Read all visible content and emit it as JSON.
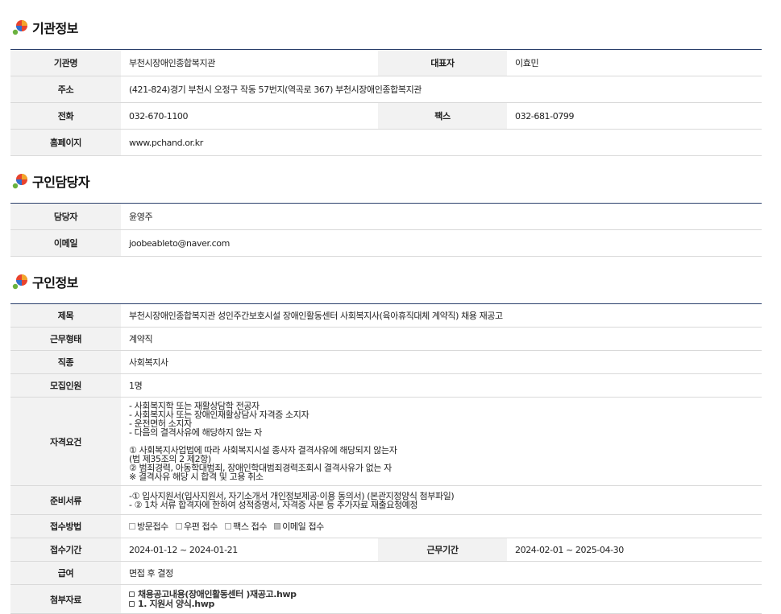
{
  "sections": {
    "agency": {
      "title": "기관정보"
    },
    "contact": {
      "title": "구인담당자"
    },
    "job": {
      "title": "구인정보"
    }
  },
  "agency": {
    "name_label": "기관명",
    "name": "부천시장애인종합복지관",
    "rep_label": "대표자",
    "rep": "이효민",
    "address_label": "주소",
    "address": "(421-824)경기 부천시 오정구 작동 57번지(역곡로 367) 부천시장애인종합복지관",
    "phone_label": "전화",
    "phone": "032-670-1100",
    "fax_label": "팩스",
    "fax": "032-681-0799",
    "homepage_label": "홈페이지",
    "homepage": "www.pchand.or.kr"
  },
  "contact": {
    "person_label": "담당자",
    "person": "윤영주",
    "email_label": "이메일",
    "email": "joobeableto@naver.com"
  },
  "job": {
    "title_label": "제목",
    "title": "부천시장애인종합복지관 성인주간보호시설 장애인활동센터 사회복지사(육아휴직대체 계약직) 채용 재공고",
    "worktype_label": "근무형태",
    "worktype": "계약직",
    "category_label": "직종",
    "category": "사회복지사",
    "headcount_label": "모집인원",
    "headcount": "1명",
    "qual_label": "자격요건",
    "qual_lines": [
      "- 사회복지학 또는 재활상담학 전공자",
      "  - 사회복지사 또는 장애인재활상담사 자격증 소지자",
      "  - 운전면허 소지자",
      "  - 다음의 결격사유에 해당하지 않는 자",
      "",
      "① 사회복지사업법에 따라 사회복지시설 종사자 결격사유에 해당되지 않는자",
      "   (법 제35조의 2 제2항)",
      "② 범죄경력, 아동학대범죄, 장애인학대범죄경력조회시 결격사유가 없는 자",
      "  ※ 결격사유 해당 시 합격 및 고용 취소"
    ],
    "docs_label": "준비서류",
    "docs_lines": [
      "-① 입사지원서(입사지원서, 자기소개서 개인정보제공·이용 동의서) (본관지정양식 첨부파일)",
      "  - ② 1차 서류 합격자에 한하여 성적증명서, 자격증 사본 등 추가자료 재출요청예정"
    ],
    "method_label": "접수방법",
    "methods": [
      {
        "label": "방문접수",
        "checked": false
      },
      {
        "label": "우편 접수",
        "checked": false
      },
      {
        "label": "팩스 접수",
        "checked": false
      },
      {
        "label": "이메일 접수",
        "checked": true
      }
    ],
    "period_label": "접수기간",
    "period": "2024-01-12 ~ 2024-01-21",
    "workperiod_label": "근무기간",
    "workperiod": "2024-02-01 ~ 2025-04-30",
    "salary_label": "급여",
    "salary": "면접 후 결정",
    "attach_label": "첨부자료",
    "attachments": [
      "채용공고내용(장애인활동센터 )재공고.hwp",
      "1. 지원서 양식.hwp"
    ]
  },
  "colors": {
    "header_line": "#2a3f6b",
    "label_bg": "#f2f2f2",
    "row_border": "#d9d9d9"
  }
}
